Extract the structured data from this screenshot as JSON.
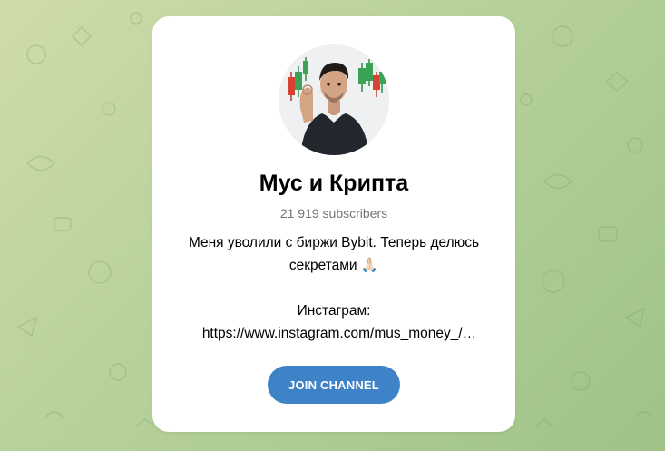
{
  "channel": {
    "name": "Мус и Крипта",
    "subscribers": "21 919 subscribers",
    "description_line1": "Меня уволили с биржи Bybit. Теперь делюсь",
    "description_line2": "секретами 🙏🏻",
    "instagram_label": "Инстаграм:",
    "instagram_url": "https://www.instagram.com/mus_money_/…"
  },
  "actions": {
    "join_label": "JOIN CHANNEL"
  },
  "colors": {
    "accent": "#3e83c8",
    "muted_text": "#707579",
    "background": "#b9d29c"
  },
  "icons": {
    "avatar": "channel-avatar-photo"
  }
}
